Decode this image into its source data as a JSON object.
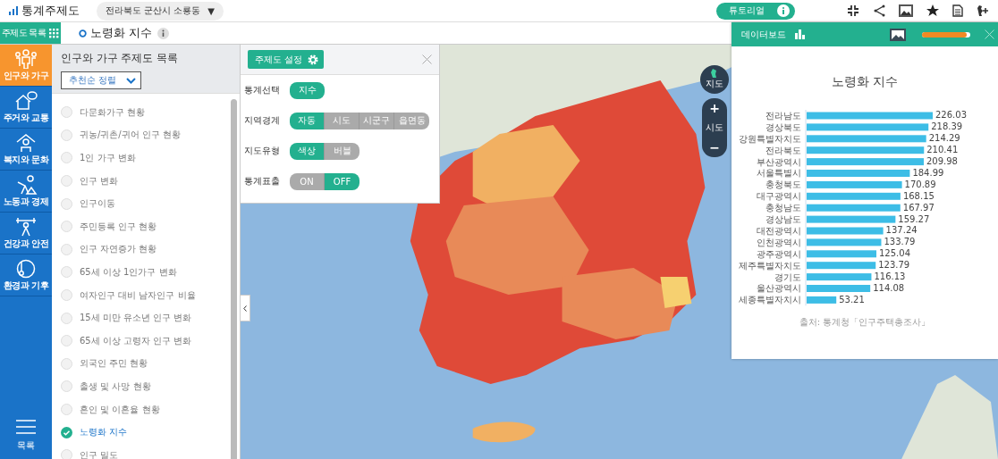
{
  "header": {
    "logo_text": "통계주제도",
    "region_select": "전라북도 군산시 소룡동",
    "region_caret": "▼",
    "tutorial_button": "튜토리얼"
  },
  "subheader": {
    "catalog_button": "주제도 목록",
    "map_title": "노령화 지수"
  },
  "categories": [
    {
      "label": "인구와 가구",
      "selected": true,
      "kind": "people"
    },
    {
      "label": "주거와 교통",
      "selected": false,
      "kind": "house"
    },
    {
      "label": "복지와 문화",
      "selected": false,
      "kind": "welfare"
    },
    {
      "label": "노동과 경제",
      "selected": false,
      "kind": "labor"
    },
    {
      "label": "건강과 안전",
      "selected": false,
      "kind": "health"
    },
    {
      "label": "환경과 기후",
      "selected": false,
      "kind": "climate"
    }
  ],
  "menu_button": "목록",
  "theme_list": {
    "title": "인구와 가구 주제도 목록",
    "sort_select": "추천순 정렬",
    "items": [
      {
        "label": "다문화가구 현황",
        "selected": false
      },
      {
        "label": "귀농/귀촌/귀어 인구 현황",
        "selected": false
      },
      {
        "label": "1인 가구 변화",
        "selected": false
      },
      {
        "label": "인구 변화",
        "selected": false
      },
      {
        "label": "인구이동",
        "selected": false
      },
      {
        "label": "주민등록 인구 현황",
        "selected": false
      },
      {
        "label": "인구 자연증가 현황",
        "selected": false
      },
      {
        "label": "65세 이상 1인가구 변화",
        "selected": false
      },
      {
        "label": "여자인구 대비 남자인구 비율",
        "selected": false
      },
      {
        "label": "15세 미만 유소년 인구 변화",
        "selected": false
      },
      {
        "label": "65세 이상 고령자 인구 변화",
        "selected": false
      },
      {
        "label": "외국인 주민 현황",
        "selected": false
      },
      {
        "label": "출생 및 사망 현황",
        "selected": false
      },
      {
        "label": "혼인 및 이혼율 현황",
        "selected": false
      },
      {
        "label": "노령화 지수",
        "selected": true
      },
      {
        "label": "인구 밀도",
        "selected": false
      }
    ]
  },
  "settings": {
    "button": "주제도 설정",
    "rows": [
      {
        "label": "통계선택",
        "options": [
          {
            "label": "지수",
            "selected": true
          }
        ]
      },
      {
        "label": "지역경계",
        "options": [
          {
            "label": "자동",
            "selected": true
          },
          {
            "label": "시도",
            "selected": false
          },
          {
            "label": "시군구",
            "selected": false
          },
          {
            "label": "읍면동",
            "selected": false
          }
        ]
      },
      {
        "label": "지도유형",
        "options": [
          {
            "label": "색상",
            "selected": true
          },
          {
            "label": "버블",
            "selected": false
          }
        ]
      },
      {
        "label": "통계표출",
        "options": [
          {
            "label": "ON",
            "selected": false
          },
          {
            "label": "OFF",
            "selected": true
          }
        ]
      }
    ]
  },
  "map_controls": {
    "map_button": "지도",
    "zoom_in": "+",
    "zoom_level": "시도",
    "zoom_out": "−"
  },
  "dashboard": {
    "title": "데이터보드",
    "opacity_slider": {
      "level": 0.93
    },
    "chart_title": "노령화 지수",
    "chart_data": {
      "type": "bar",
      "orientation": "horizontal",
      "categories": [
        "전라남도",
        "경상북도",
        "강원특별자치도",
        "전라북도",
        "부산광역시",
        "서울특별시",
        "충청북도",
        "대구광역시",
        "충청남도",
        "경상남도",
        "대전광역시",
        "인천광역시",
        "광주광역시",
        "제주특별자치도",
        "경기도",
        "울산광역시",
        "세종특별자치시"
      ],
      "series": [
        {
          "color": "#3dbde6",
          "values": [
            226.03,
            218.39,
            214.29,
            210.41,
            209.98,
            184.99,
            170.89,
            168.15,
            167.97,
            159.27,
            137.24,
            133.79,
            125.04,
            123.79,
            116.13,
            114.08,
            53.21
          ]
        }
      ],
      "data_labels": true
    },
    "source": "출처: 통계청「인구주택총조사」"
  }
}
